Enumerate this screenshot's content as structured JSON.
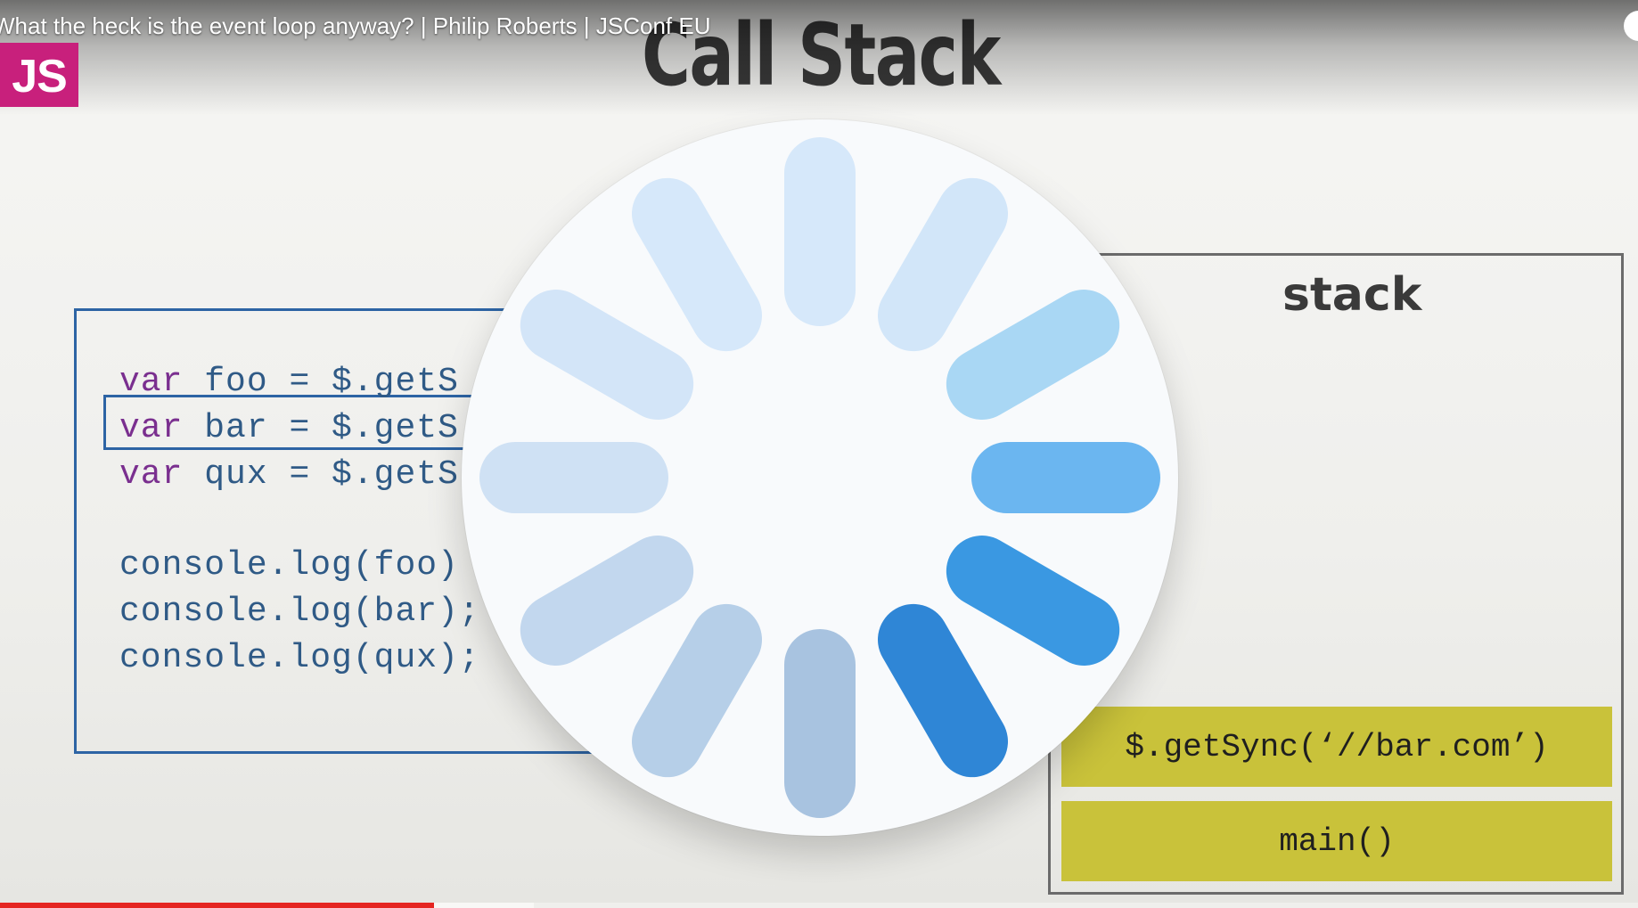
{
  "video": {
    "title": "What the heck is the event loop anyway? | Philip Roberts | JSConf EU",
    "channel_badge": "JS",
    "channel_color": "#c8207c"
  },
  "slide": {
    "title": "Call Stack",
    "code_lines": [
      {
        "kw": "var",
        "rest": " foo = $.getS"
      },
      {
        "kw": "var",
        "rest": " bar = $.getS"
      },
      {
        "kw": "var",
        "rest": " qux = $.getS"
      },
      {
        "kw": "",
        "rest": ""
      },
      {
        "kw": "",
        "rest": "console.log(foo)"
      },
      {
        "kw": "",
        "rest": "console.log(bar);"
      },
      {
        "kw": "",
        "rest": "console.log(qux);"
      }
    ],
    "highlighted_line_index": 1,
    "stack": {
      "heading": "stack",
      "frames": [
        "$.getSync(‘//bar.com’)",
        "main()"
      ],
      "frame_color": "#c9c23a"
    }
  },
  "loading_spinner": {
    "icon": "loading-spinner-icon",
    "colors": [
      "#cfe4f8",
      "#a9d7f4",
      "#6bb6f0",
      "#3a98e2",
      "#2f86d6",
      "#a8c3e0"
    ]
  },
  "progress": {
    "played_fraction": 0.265,
    "buffered_fraction": 0.326,
    "played_color": "#e52521"
  }
}
